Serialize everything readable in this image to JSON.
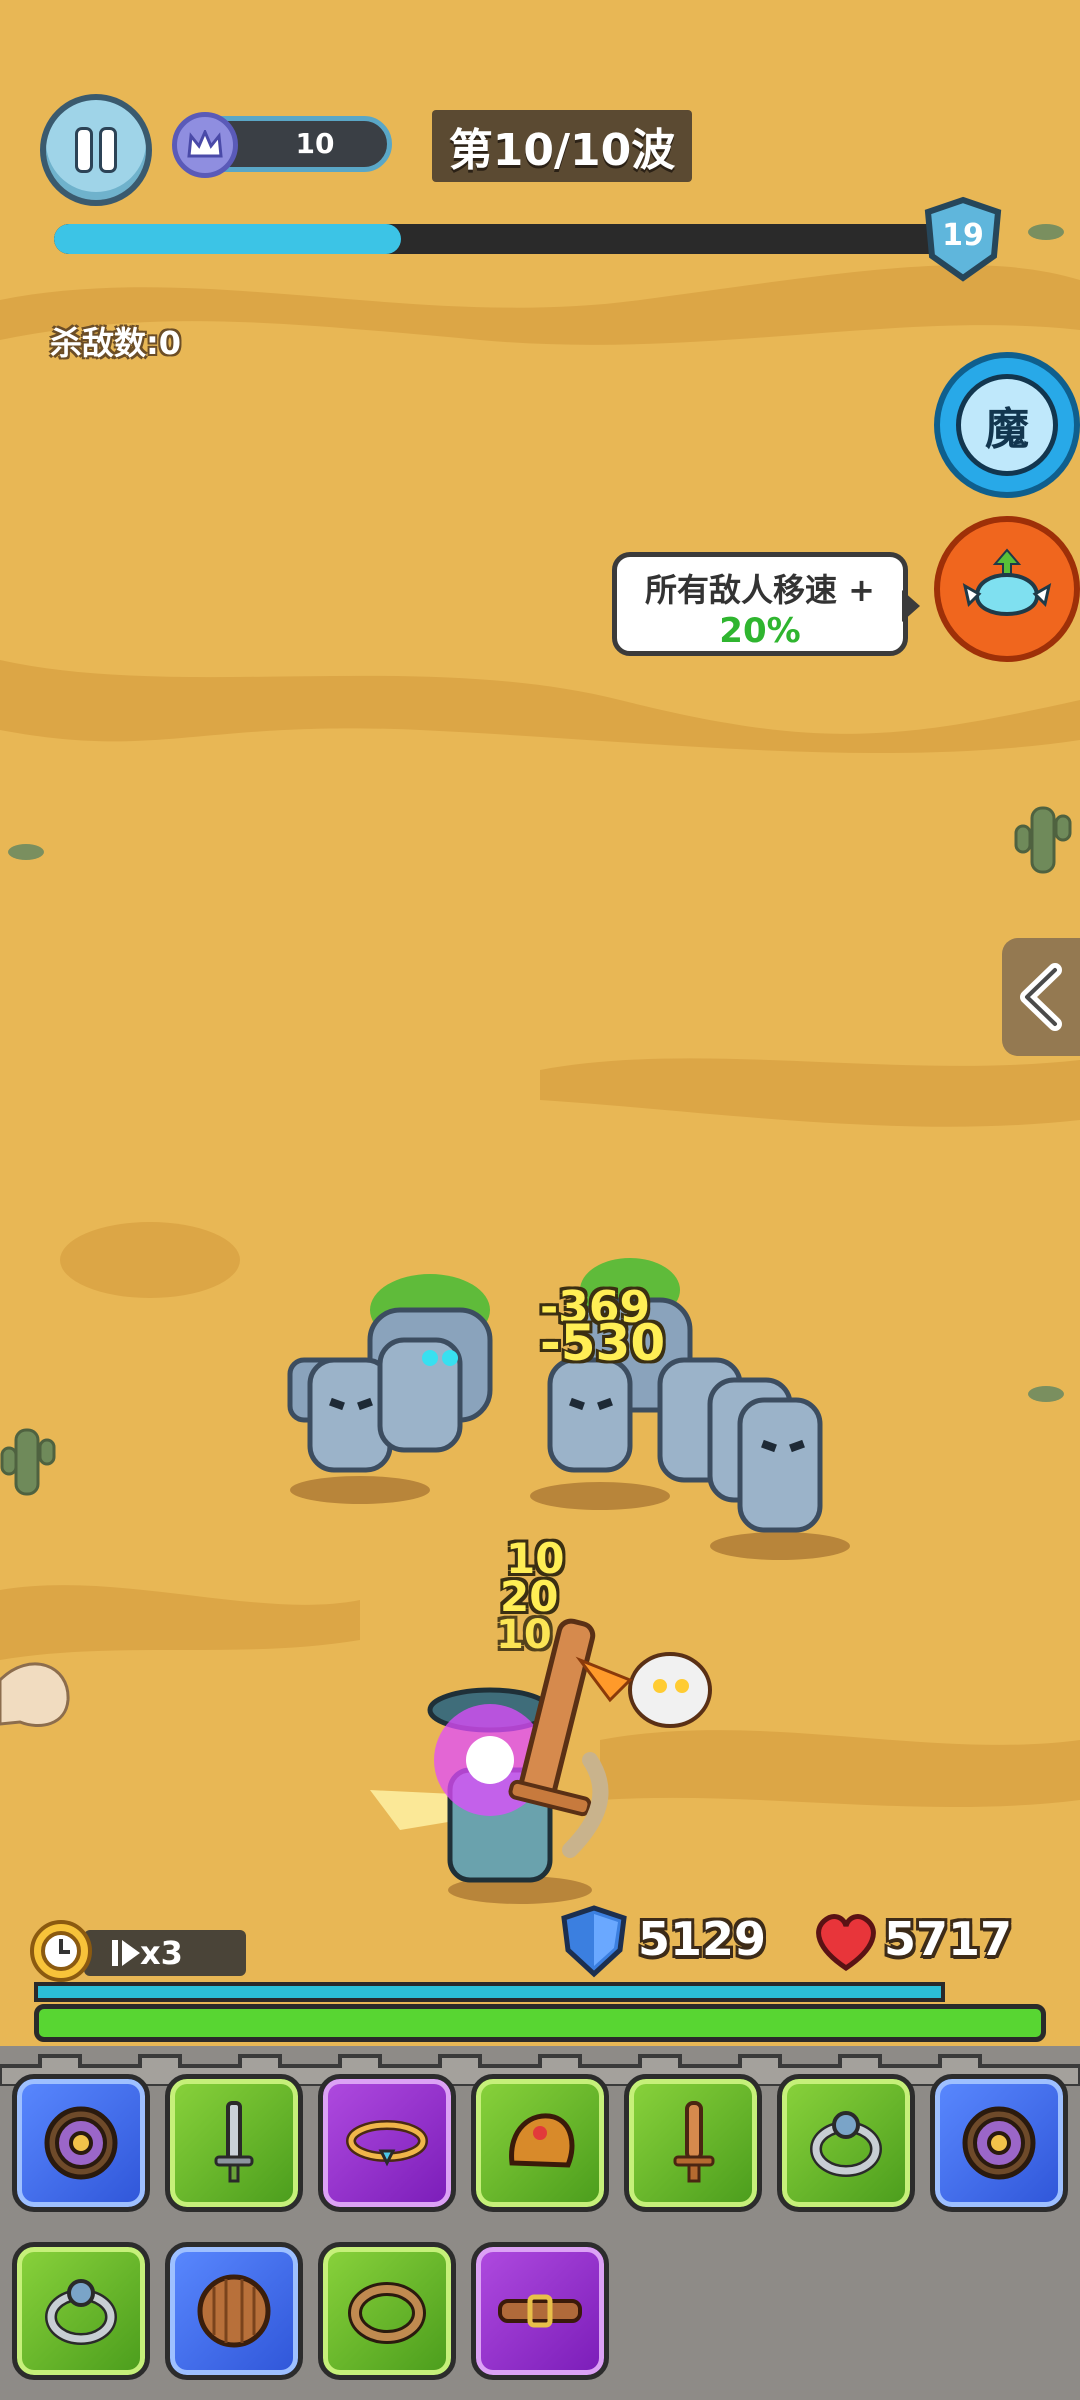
{
  "hud": {
    "crown_count": "10",
    "wave_label": "第10/10波",
    "wave_progress": 0.39,
    "level_badge": "19",
    "kill_count_label": "杀敌数:0"
  },
  "side_buttons": {
    "magic_label": "魔",
    "buff_line1": "所有敌人移速 +",
    "buff_line2": "20%"
  },
  "combat_text": {
    "enemy_damage": [
      "-369",
      "-530"
    ],
    "hero_damage": [
      "10",
      "20",
      "10"
    ]
  },
  "player": {
    "speed_label": "x3",
    "shield": "5129",
    "hp": "5717",
    "shield_fill": 0.9,
    "hp_fill": 1.0
  },
  "equipment": {
    "row1": [
      {
        "icon": "round-shield-icon",
        "rarity": "blue"
      },
      {
        "icon": "sword-icon",
        "rarity": "green"
      },
      {
        "icon": "necklace-icon",
        "rarity": "purple"
      },
      {
        "icon": "helmet-icon",
        "rarity": "green"
      },
      {
        "icon": "wooden-sword-icon",
        "rarity": "green"
      },
      {
        "icon": "ring-icon",
        "rarity": "green"
      },
      {
        "icon": "round-shield-icon",
        "rarity": "blue"
      }
    ],
    "row2": [
      {
        "icon": "ring-icon",
        "rarity": "green"
      },
      {
        "icon": "wooden-shield-icon",
        "rarity": "blue"
      },
      {
        "icon": "bronze-ring-icon",
        "rarity": "green"
      },
      {
        "icon": "belt-icon",
        "rarity": "purple"
      }
    ]
  },
  "colors": {
    "sand": "#e8b755",
    "progress": "#3cc4e6",
    "hp": "#58d632",
    "shield": "#2bbfd6"
  }
}
